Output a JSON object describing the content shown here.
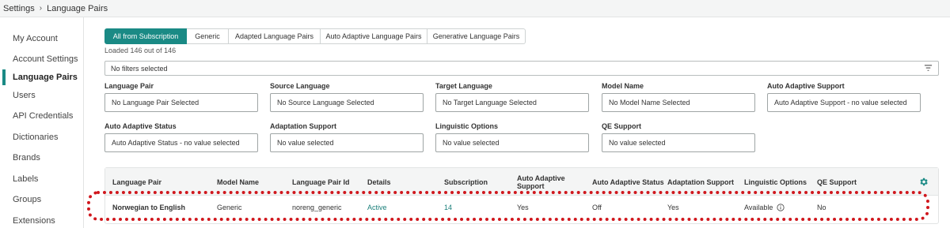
{
  "breadcrumb": {
    "root": "Settings",
    "current": "Language Pairs"
  },
  "sidebar": {
    "items": [
      {
        "label": "My Account"
      },
      {
        "label": "Account Settings"
      },
      {
        "label": "Language Pairs"
      },
      {
        "label": "Users"
      },
      {
        "label": "API Credentials"
      },
      {
        "label": "Dictionaries"
      },
      {
        "label": "Brands"
      },
      {
        "label": "Labels"
      },
      {
        "label": "Groups"
      },
      {
        "label": "Extensions"
      }
    ],
    "active_index": 2
  },
  "tabs": [
    {
      "label": "All from Subscription"
    },
    {
      "label": "Generic"
    },
    {
      "label": "Adapted Language Pairs"
    },
    {
      "label": "Auto Adaptive Language Pairs"
    },
    {
      "label": "Generative Language Pairs"
    }
  ],
  "loaded_text": "Loaded 146 out of 146",
  "filter_bar": {
    "value": "No filters selected"
  },
  "filters": [
    {
      "label": "Language Pair",
      "value": "No Language Pair Selected"
    },
    {
      "label": "Source Language",
      "value": "No Source Language Selected"
    },
    {
      "label": "Target Language",
      "value": "No Target Language Selected"
    },
    {
      "label": "Model Name",
      "value": "No Model Name Selected"
    },
    {
      "label": "Auto Adaptive Support",
      "value": "Auto Adaptive Support - no value selected"
    },
    {
      "label": "Auto Adaptive Status",
      "value": "Auto Adaptive Status - no value selected"
    },
    {
      "label": "Adaptation Support",
      "value": "No value selected"
    },
    {
      "label": "Linguistic Options",
      "value": "No value selected"
    },
    {
      "label": "QE Support",
      "value": "No value selected"
    }
  ],
  "table": {
    "columns": [
      "Language Pair",
      "Model Name",
      "Language Pair Id",
      "Details",
      "Subscription",
      "Auto Adaptive Support",
      "Auto Adaptive Status",
      "Adaptation Support",
      "Linguistic Options",
      "QE Support"
    ],
    "rows": [
      {
        "language_pair": "Norwegian to English",
        "model_name": "Generic",
        "language_pair_id": "noreng_generic",
        "details": "Active",
        "subscription": "14",
        "auto_adaptive_support": "Yes",
        "auto_adaptive_status": "Off",
        "adaptation_support": "Yes",
        "linguistic_options": "Available",
        "qe_support": "No"
      }
    ]
  },
  "colors": {
    "accent": "#1a8a85",
    "highlight": "#d0171d"
  },
  "icons": {
    "filter": "filter-icon",
    "settings": "gear-icon",
    "info": "info-icon",
    "breadcrumb_separator": "chevron-right-icon"
  }
}
